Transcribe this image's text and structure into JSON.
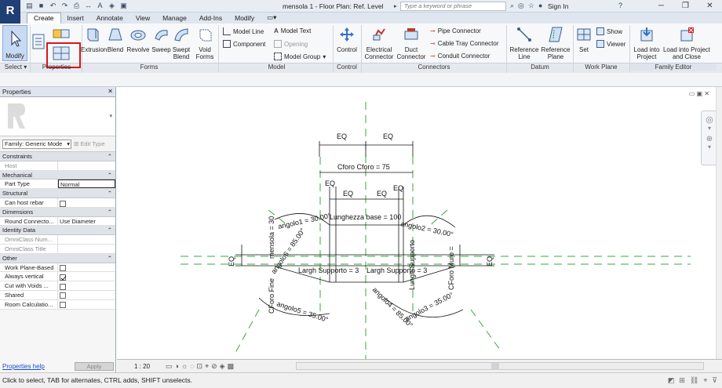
{
  "titlebar": {
    "app_letter": "R",
    "window_title": "mensola 1 - Floor Plan: Ref. Level",
    "search_placeholder": "Type a keyword or phrase",
    "sign_in": "Sign In",
    "help": "?"
  },
  "tabs": [
    {
      "label": "Create",
      "active": true
    },
    {
      "label": "Insert"
    },
    {
      "label": "Annotate"
    },
    {
      "label": "View"
    },
    {
      "label": "Manage"
    },
    {
      "label": "Add-Ins"
    },
    {
      "label": "Modify"
    }
  ],
  "ribbon": {
    "modify": "Modify",
    "select_panel": "Select",
    "properties_panel": "Properties",
    "forms": {
      "label": "Forms",
      "buttons": [
        "Extrusion",
        "Blend",
        "Revolve",
        "Sweep",
        "Swept Blend",
        "Void Forms"
      ]
    },
    "model": {
      "label": "Model",
      "items": [
        "Model Line",
        "Model Text",
        "Component",
        "Opening",
        "Model Group"
      ]
    },
    "control": {
      "label": "Control",
      "button": "Control"
    },
    "connectors": {
      "label": "Connectors",
      "buttons": [
        "Electrical Connector",
        "Duct Connector"
      ],
      "items": [
        "Pipe Connector",
        "Cable Tray Connector",
        "Conduit Connector"
      ]
    },
    "datum": {
      "label": "Datum",
      "buttons": [
        "Reference Line",
        "Reference Plane"
      ]
    },
    "workplane": {
      "label": "Work Plane",
      "set": "Set",
      "show": "Show",
      "viewer": "Viewer"
    },
    "family_editor": {
      "label": "Family Editor",
      "buttons": [
        "Load into Project",
        "Load into Project and Close"
      ]
    }
  },
  "properties": {
    "title": "Properties",
    "family": "Family: Generic Mode",
    "edit_type": "Edit Type",
    "groups": [
      {
        "name": "Constraints",
        "rows": [
          {
            "k": "Host",
            "v": "",
            "dim": true
          }
        ]
      },
      {
        "name": "Mechanical",
        "rows": [
          {
            "k": "Part Type",
            "v": "Normal"
          }
        ]
      },
      {
        "name": "Structural",
        "rows": [
          {
            "k": "Can host rebar",
            "cb": false
          }
        ]
      },
      {
        "name": "Dimensions",
        "rows": [
          {
            "k": "Round Connecto...",
            "v": "Use Diameter"
          }
        ]
      },
      {
        "name": "Identity Data",
        "rows": [
          {
            "k": "OmniClass Num...",
            "v": "",
            "dim": true
          },
          {
            "k": "OmniClass Title",
            "v": "",
            "dim": true
          }
        ]
      },
      {
        "name": "Other",
        "rows": [
          {
            "k": "Work Plane-Based",
            "cb": false
          },
          {
            "k": "Always vertical",
            "cb": true
          },
          {
            "k": "Cut with Voids ...",
            "cb": false
          },
          {
            "k": "Shared",
            "cb": false
          },
          {
            "k": "Room Calculatio...",
            "cb": false
          }
        ]
      }
    ],
    "help_link": "Properties help",
    "apply": "Apply"
  },
  "drawing": {
    "labels": {
      "eq": "EQ",
      "cforo": "Cforo Cforo = 75",
      "lunghezza": "Lunghezza base = 100",
      "angolo1": "angolo1 = 30.00°",
      "angolo2": "angolo2 = 30.00°",
      "angolo3": "angolo3 = 35.00°",
      "angolo4": "angolo4 = 85.00°",
      "angolo5": "angolo5 = 35.00°",
      "angolo6": "angolo6 = 85.00°",
      "largh1": "Largh Supporto = 3",
      "largh2": "Largh Supporto = 3",
      "lungh_supporto": "Lungh Supporto",
      "cforo_muro": "CForo Muro = ",
      "cforo_fine": "CForo Fine",
      "mensola": "mensola = 30"
    }
  },
  "viewbar": {
    "scale": "1 : 20"
  },
  "status": {
    "text": "Click to select, TAB for alternates, CTRL adds, SHIFT unselects."
  }
}
